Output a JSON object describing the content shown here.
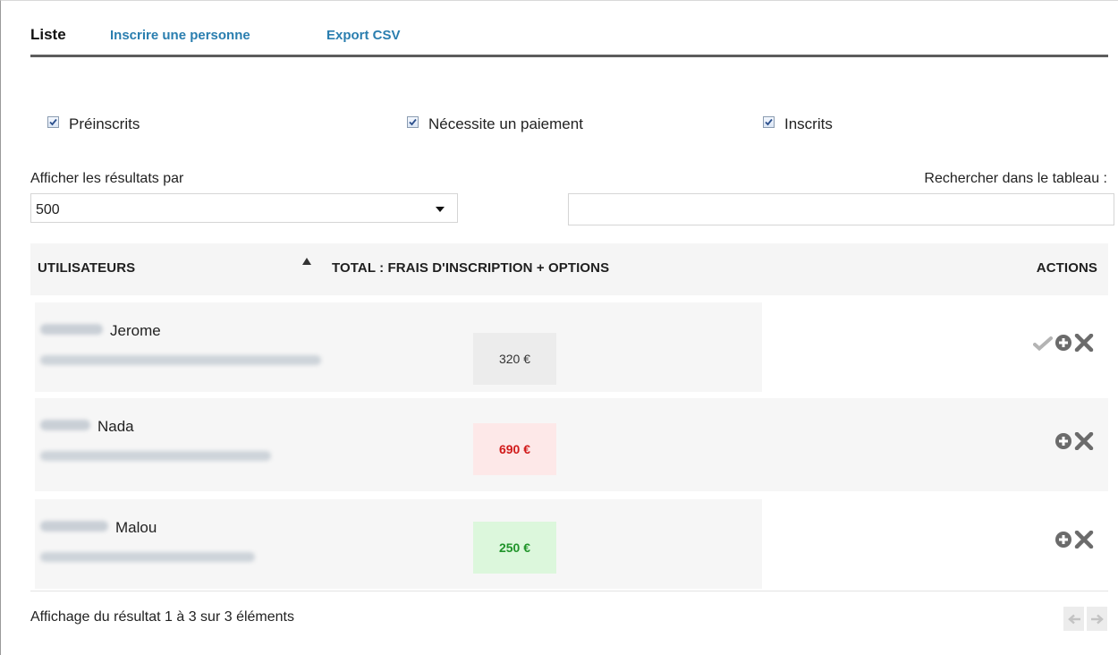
{
  "tabs": {
    "liste": "Liste",
    "inscrire": "Inscrire une personne",
    "export": "Export CSV"
  },
  "filters": {
    "preinscrits": {
      "label": "Préinscrits",
      "checked": true
    },
    "paiement": {
      "label": "Nécessite un paiement",
      "checked": true
    },
    "inscrits": {
      "label": "Inscrits",
      "checked": true
    }
  },
  "per_page": {
    "label": "Afficher les résultats par",
    "value": "500"
  },
  "search": {
    "label": "Rechercher dans le tableau :",
    "value": ""
  },
  "table": {
    "headers": {
      "users": "UTILISATEURS",
      "total": "TOTAL : FRAIS D'INSCRIPTION + OPTIONS",
      "actions": "ACTIONS"
    },
    "rows": [
      {
        "name": "Jerome",
        "amount": "320 €",
        "status": "neutral",
        "icons": [
          "check-icon",
          "plus-circle-icon",
          "close-icon"
        ]
      },
      {
        "name": "Nada",
        "amount": "690 €",
        "status": "unpaid",
        "icons": [
          "plus-circle-icon",
          "close-icon"
        ]
      },
      {
        "name": "Malou",
        "amount": "250 €",
        "status": "paid",
        "icons": [
          "plus-circle-icon",
          "close-icon"
        ]
      }
    ]
  },
  "footer": {
    "info": "Affichage du résultat 1 à 3 sur 3 éléments",
    "icons": [
      "arrow-left-icon",
      "arrow-right-icon"
    ]
  },
  "colors": {
    "link": "#2a7eaf",
    "unpaid_bg": "#fde8e8",
    "unpaid_text": "#d11a1a",
    "paid_bg": "#dcf7dc",
    "paid_text": "#20942a",
    "icon_gray": "#6b6b6b"
  }
}
